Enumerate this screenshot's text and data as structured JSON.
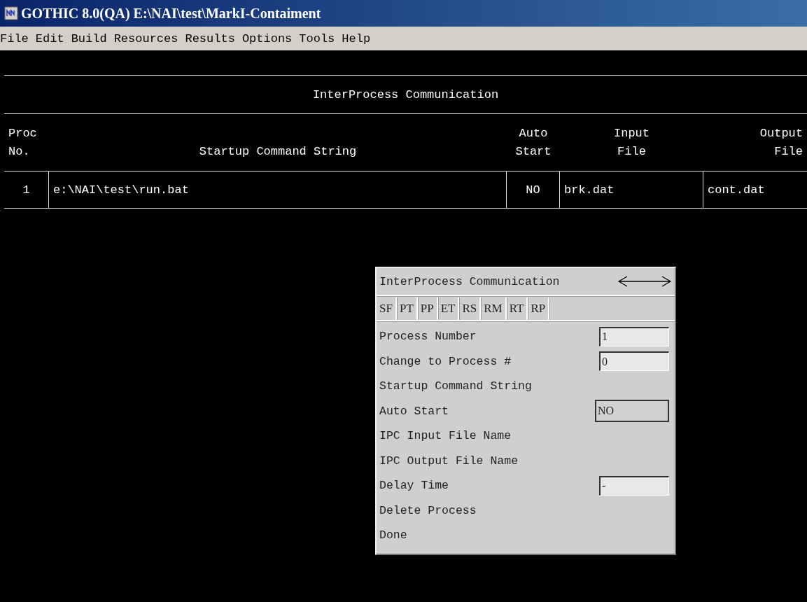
{
  "window": {
    "title": "GOTHIC 8.0(QA) E:\\NAI\\test\\MarkI-Contaiment"
  },
  "menu": [
    "File",
    "Edit",
    "Build",
    "Resources",
    "Results",
    "Options",
    "Tools",
    "Help"
  ],
  "table": {
    "title": "InterProcess Communication",
    "columns": [
      {
        "lines": [
          "Proc",
          "No."
        ]
      },
      {
        "lines": [
          "Startup Command String"
        ]
      },
      {
        "lines": [
          "Auto",
          "Start"
        ]
      },
      {
        "lines": [
          "Input",
          "File"
        ]
      },
      {
        "lines": [
          "Output",
          "File"
        ]
      }
    ],
    "rows": [
      [
        "1",
        "e:\\NAI\\test\\run.bat",
        "NO",
        "brk.dat",
        "cont.dat"
      ]
    ]
  },
  "dialog": {
    "title": "InterProcess Communication",
    "tabs": [
      "SF",
      "PT",
      "PP",
      "ET",
      "RS",
      "RM",
      "RT",
      "RP"
    ],
    "items": [
      {
        "kind": "field",
        "label": "Process Number",
        "value": "1"
      },
      {
        "kind": "field",
        "label": "Change to Process #",
        "value": "0"
      },
      {
        "kind": "item",
        "label": "Startup Command String"
      },
      {
        "kind": "select",
        "label": "Auto Start",
        "value": "NO"
      },
      {
        "kind": "item",
        "label": "IPC Input File Name"
      },
      {
        "kind": "item",
        "label": "IPC Output File Name"
      },
      {
        "kind": "field",
        "label": "Delay Time",
        "value": "-"
      },
      {
        "kind": "item",
        "label": "Delete Process"
      },
      {
        "kind": "item",
        "label": "Done"
      }
    ]
  }
}
